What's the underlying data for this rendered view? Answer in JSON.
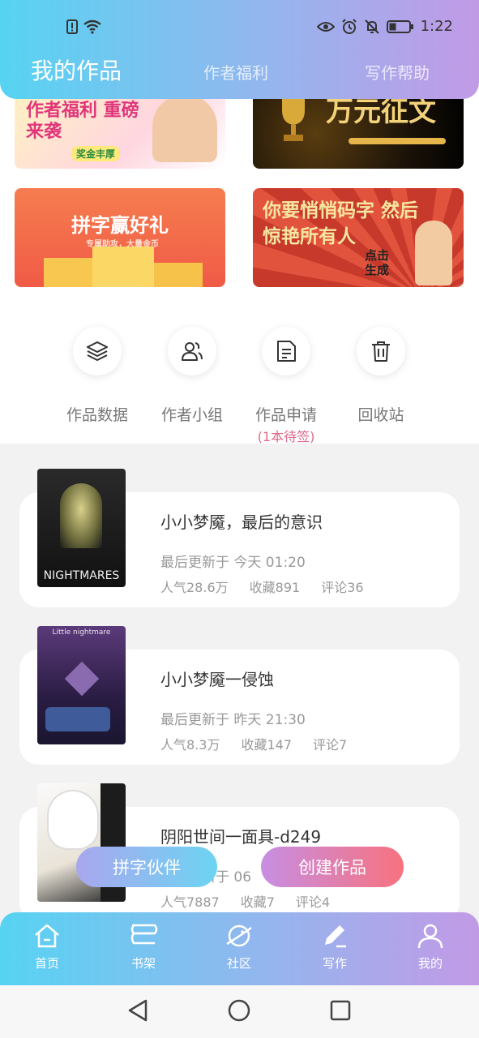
{
  "status": {
    "time": "1:22"
  },
  "tabs": [
    {
      "label": "我的作品",
      "active": true
    },
    {
      "label": "作者福利",
      "active": false
    },
    {
      "label": "写作帮助",
      "active": false
    }
  ],
  "banners": [
    {
      "text": "作者福利 重磅来袭",
      "sub": "奖金丰厚"
    },
    {
      "text": "万元征文",
      "sub": ""
    },
    {
      "text": "拼字赢好礼",
      "sub": "专属助攻，大量金币"
    },
    {
      "text": "你要悄悄码字 然后惊艳所有人",
      "sub": "点击生成"
    }
  ],
  "quick_actions": [
    {
      "label": "作品数据",
      "icon": "layers-icon"
    },
    {
      "label": "作者小组",
      "icon": "group-icon"
    },
    {
      "label": "作品申请",
      "icon": "document-icon",
      "sub": "(1本待签)"
    },
    {
      "label": "回收站",
      "icon": "trash-icon"
    }
  ],
  "works": [
    {
      "title": "小小梦魇，最后的意识",
      "updated": "最后更新于 今天 01:20",
      "popularity": "人气28.6万",
      "favorites": "收藏891",
      "comments": "评论36",
      "cover_caption": "NIGHTMARES"
    },
    {
      "title": "小小梦魇一侵蚀",
      "updated": "最后更新于 昨天 21:30",
      "popularity": "人气8.3万",
      "favorites": "收藏147",
      "comments": "评论7",
      "cover_caption": "Little nightmare"
    },
    {
      "title": "阴阳世间一面具-d249",
      "updated": "最后更新于 06",
      "popularity": "人气7887",
      "favorites": "收藏7",
      "comments": "评论4",
      "cover_caption": ""
    }
  ],
  "floating": {
    "partner": "拼字伙伴",
    "create": "创建作品"
  },
  "bottom_nav": [
    {
      "label": "首页",
      "icon": "home-icon"
    },
    {
      "label": "书架",
      "icon": "bookshelf-icon"
    },
    {
      "label": "社区",
      "icon": "planet-icon"
    },
    {
      "label": "写作",
      "icon": "pen-icon"
    },
    {
      "label": "我的",
      "icon": "profile-icon"
    }
  ]
}
